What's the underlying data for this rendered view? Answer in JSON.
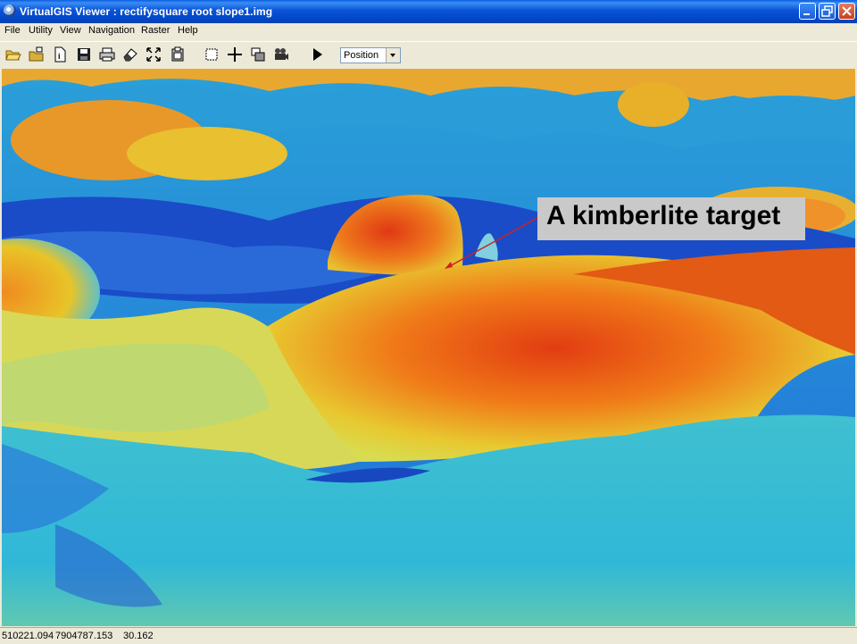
{
  "window": {
    "title": "VirtualGIS Viewer : rectifysquare root slope1.img",
    "controls": [
      "minimize",
      "maximize",
      "close"
    ]
  },
  "menu": {
    "items": [
      "File",
      "Utility",
      "View",
      "Navigation",
      "Raster",
      "Help"
    ]
  },
  "toolbar": {
    "icons": [
      "open-folder-icon",
      "open-layer-icon",
      "document-info-icon",
      "save-icon",
      "print-icon",
      "eraser-icon",
      "fit-extent-icon",
      "copy-clipboard-icon",
      "frame-icon",
      "crosshair-icon",
      "snapshot-icon",
      "camera-icon",
      "play-icon"
    ],
    "mode_value": "Position"
  },
  "viewport": {
    "annotation": "A kimberlite target",
    "colors": {
      "high_slope": "#e03a10",
      "mid_slope": "#e8d028",
      "low_slope": "#20a8e0",
      "lowest_slope": "#1848c8",
      "arrow": "#d02020"
    }
  },
  "status": {
    "easting": "510221.094",
    "northing": "7904787.153",
    "value": "30.162"
  }
}
